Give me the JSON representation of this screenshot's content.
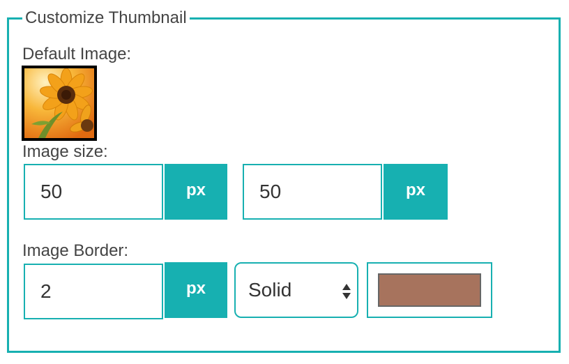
{
  "panel": {
    "legend": "Customize Thumbnail"
  },
  "default_image": {
    "label": "Default Image:",
    "thumbnail_icon": "sunflower-image"
  },
  "image_size": {
    "label": "Image size:",
    "width_value": "50",
    "width_unit": "px",
    "height_value": "50",
    "height_unit": "px"
  },
  "image_border": {
    "label": "Image Border:",
    "width_value": "2",
    "width_unit": "px",
    "style_selected": "Solid",
    "color_hex": "#a7735d"
  },
  "colors": {
    "accent": "#17b0b1"
  }
}
